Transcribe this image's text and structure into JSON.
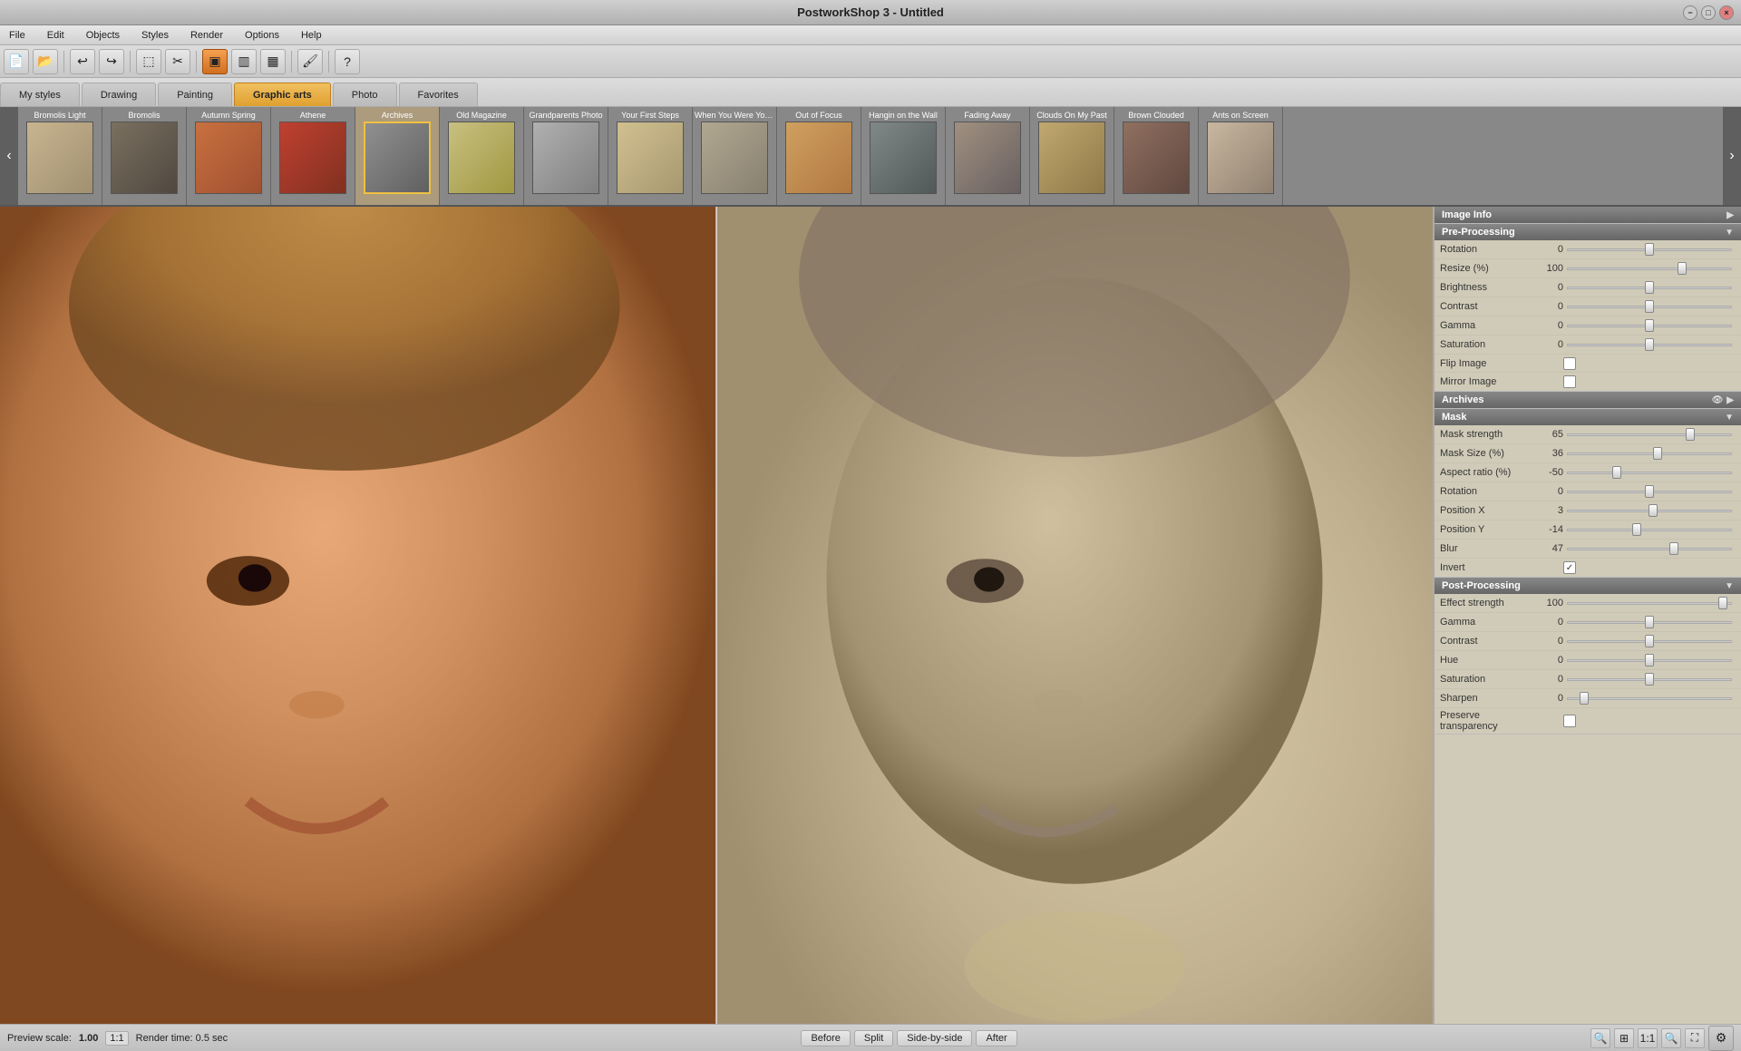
{
  "titlebar": {
    "title": "PostworkShop 3 - Untitled"
  },
  "menubar": {
    "items": [
      "File",
      "Edit",
      "Objects",
      "Styles",
      "Render",
      "Options",
      "Help"
    ]
  },
  "toolbar": {
    "buttons": [
      "new",
      "open",
      "sep",
      "undo",
      "redo",
      "sep",
      "select",
      "crop",
      "sep",
      "rect-btn",
      "grid1",
      "grid2",
      "grid3",
      "sep",
      "paint",
      "sep",
      "help"
    ]
  },
  "styletabs": {
    "tabs": [
      {
        "label": "My styles",
        "active": false
      },
      {
        "label": "Drawing",
        "active": false
      },
      {
        "label": "Painting",
        "active": false
      },
      {
        "label": "Graphic arts",
        "active": true
      },
      {
        "label": "Photo",
        "active": false
      },
      {
        "label": "Favorites",
        "active": false
      }
    ]
  },
  "presets": [
    {
      "label": "Bromolis Light",
      "thumb": "bromolislight",
      "active": false
    },
    {
      "label": "Bromolis",
      "thumb": "bromolis",
      "active": false
    },
    {
      "label": "Autumn Spring",
      "thumb": "autumnspring",
      "active": false
    },
    {
      "label": "Athene",
      "thumb": "athene",
      "active": false
    },
    {
      "label": "Archives",
      "thumb": "archives",
      "active": true
    },
    {
      "label": "Old Magazine",
      "thumb": "oldmagazine",
      "active": false
    },
    {
      "label": "Grandparents Photo",
      "thumb": "grandparents",
      "active": false
    },
    {
      "label": "Your First Steps",
      "thumb": "yourfirst",
      "active": false
    },
    {
      "label": "When You Were Young",
      "thumb": "whenyou",
      "active": false
    },
    {
      "label": "Out of Focus",
      "thumb": "outoffocus",
      "active": false
    },
    {
      "label": "Hangin on the Wall",
      "thumb": "hangin",
      "active": false
    },
    {
      "label": "Fading Away",
      "thumb": "fadingaway",
      "active": false
    },
    {
      "label": "Clouds On My Past",
      "thumb": "cloudsonmy",
      "active": false
    },
    {
      "label": "Brown Clouded",
      "thumb": "brownclouded",
      "active": false
    },
    {
      "label": "Ants on Screen",
      "thumb": "antsonscreen",
      "active": false
    }
  ],
  "panels": {
    "image_info": {
      "header": "Image Info",
      "collapsed": true
    },
    "preprocessing": {
      "header": "Pre-Processing",
      "rows": [
        {
          "label": "Rotation",
          "value": "0",
          "type": "slider",
          "thumb_pct": 50
        },
        {
          "label": "Resize (%)",
          "value": "100",
          "type": "slider",
          "thumb_pct": 70
        },
        {
          "label": "Brightness",
          "value": "0",
          "type": "slider",
          "thumb_pct": 50
        },
        {
          "label": "Contrast",
          "value": "0",
          "type": "slider",
          "thumb_pct": 50
        },
        {
          "label": "Gamma",
          "value": "0",
          "type": "slider",
          "thumb_pct": 50
        },
        {
          "label": "Saturation",
          "value": "0",
          "type": "slider",
          "thumb_pct": 50
        },
        {
          "label": "Flip Image",
          "value": "",
          "type": "checkbox",
          "checked": false
        },
        {
          "label": "Mirror Image",
          "value": "",
          "type": "checkbox",
          "checked": false
        }
      ]
    },
    "archives": {
      "header": "Archives"
    },
    "mask": {
      "header": "Mask",
      "rows": [
        {
          "label": "Mask strength",
          "value": "65",
          "type": "slider",
          "thumb_pct": 75
        },
        {
          "label": "Mask Size (%)",
          "value": "36",
          "type": "slider",
          "thumb_pct": 55
        },
        {
          "label": "Aspect ratio (%)",
          "value": "-50",
          "type": "slider",
          "thumb_pct": 30
        },
        {
          "label": "Rotation",
          "value": "0",
          "type": "slider",
          "thumb_pct": 50
        },
        {
          "label": "Position X",
          "value": "3",
          "type": "slider",
          "thumb_pct": 52
        },
        {
          "label": "Position Y",
          "value": "-14",
          "type": "slider",
          "thumb_pct": 42
        },
        {
          "label": "Blur",
          "value": "47",
          "type": "slider",
          "thumb_pct": 65
        },
        {
          "label": "Invert",
          "value": "",
          "type": "checkbox",
          "checked": true
        }
      ]
    },
    "postprocessing": {
      "header": "Post-Processing",
      "rows": [
        {
          "label": "Effect strength",
          "value": "100",
          "type": "slider",
          "thumb_pct": 95
        },
        {
          "label": "Gamma",
          "value": "0",
          "type": "slider",
          "thumb_pct": 50
        },
        {
          "label": "Contrast",
          "value": "0",
          "type": "slider",
          "thumb_pct": 50
        },
        {
          "label": "Hue",
          "value": "0",
          "type": "slider",
          "thumb_pct": 50
        },
        {
          "label": "Saturation",
          "value": "0",
          "type": "slider",
          "thumb_pct": 50
        },
        {
          "label": "Sharpen",
          "value": "0",
          "type": "slider",
          "thumb_pct": 10
        },
        {
          "label": "Preserve transparency",
          "value": "",
          "type": "checkbox",
          "checked": false
        }
      ]
    }
  },
  "bottombar": {
    "preview_label": "Preview scale:",
    "scale_value": "1.00",
    "scale_ratio": "1:1",
    "render_label": "Render time: 0.5 sec",
    "view_buttons": [
      "Before",
      "Split",
      "Side-by-side",
      "After"
    ]
  }
}
